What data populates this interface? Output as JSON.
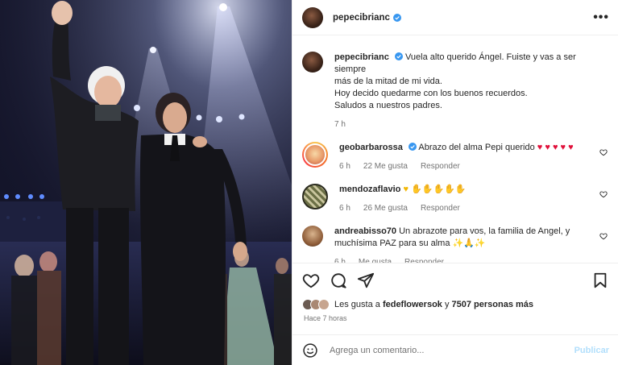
{
  "post": {
    "author": "pepecibrianc",
    "author_verified": true,
    "photo_alt": "Two men on stage waving"
  },
  "caption": {
    "user": "pepecibrianc",
    "lines": [
      "Vuela alto querido Ángel. Fuiste y vas a ser siempre",
      "más de la mitad de mi vida.",
      "Hoy decido quedarme con los buenos recuerdos.",
      "Saludos a nuestros padres."
    ],
    "time": "7 h"
  },
  "comments": [
    {
      "user": "geobarbarossa",
      "verified": true,
      "text": "Abrazo del alma Pepi querido",
      "emoji": "♥ ♥ ♥ ♥ ♥",
      "time": "6 h",
      "likes": "22 Me gusta",
      "reply": "Responder"
    },
    {
      "user": "mendozaflavio",
      "verified": false,
      "text": "",
      "emoji": "♥ ✋✋✋✋✋",
      "time": "6 h",
      "likes": "26 Me gusta",
      "reply": "Responder"
    },
    {
      "user": "andreabisso70",
      "verified": false,
      "text": "Un abrazote para vos, la familia de Angel, y muchísima PAZ para su alma",
      "emoji": "✨🙏✨",
      "time": "6 h",
      "likes": "Me gusta",
      "reply": "Responder"
    }
  ],
  "likes": {
    "prefix": "Les gusta a",
    "user": "fedeflowersok",
    "mid": "y",
    "count": "7507 personas más"
  },
  "timestamp": "Hace 7 horas",
  "composer": {
    "placeholder": "Agrega un comentario...",
    "publish": "Publicar"
  },
  "icons": {
    "more": "more-options-icon",
    "like": "heart-icon",
    "comment": "comment-icon",
    "share": "share-icon",
    "save": "bookmark-icon",
    "emoji": "emoji-icon",
    "verified": "verified-badge-icon"
  },
  "colors": {
    "verified": "#3897f0",
    "heart_red": "#e0103a",
    "publish_disabled": "#b2dffc",
    "muted": "#737373"
  }
}
